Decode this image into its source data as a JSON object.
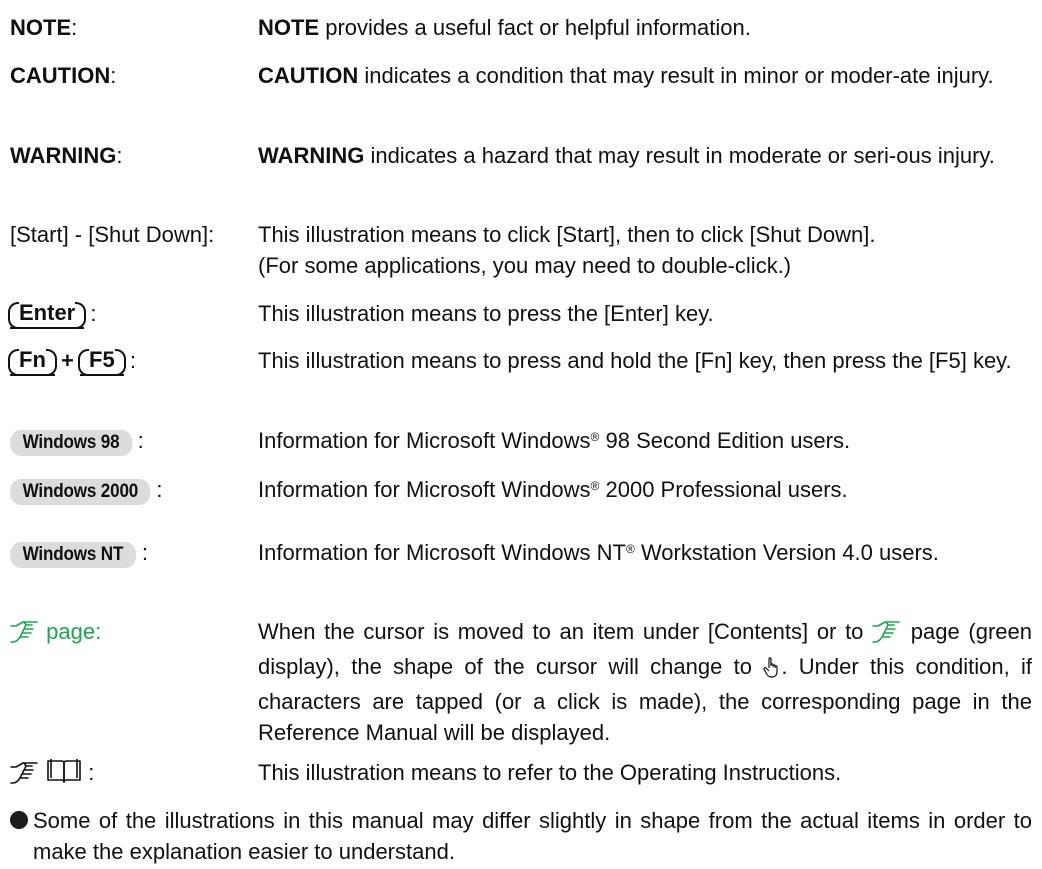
{
  "rows": [
    {
      "term": "NOTE",
      "colon": ":",
      "lead": "NOTE",
      "text": " provides a useful fact or helpful information."
    },
    {
      "term": "CAUTION",
      "colon": ":",
      "lead": "CAUTION",
      "text": " indicates a condition that may result in minor or moder-ate injury."
    },
    {
      "term": "WARNING",
      "colon": ":",
      "lead": "WARNING",
      "text": " indicates a hazard that may result in moderate or seri-ous injury."
    },
    {
      "term": "[Start] - [Shut Down]:",
      "text": "This illustration means to click [Start], then to click [Shut Down].",
      "text2": "(For some applications, you may need to double-click.)"
    },
    {
      "key": "Enter",
      "colon": ":",
      "text": "This illustration means to press the [Enter] key."
    },
    {
      "key1": "Fn",
      "plus": "+",
      "key2": "F5",
      "colon": ":",
      "text": "This illustration means to press and hold the [Fn] key, then press the [F5] key."
    },
    {
      "badge": "Windows 98",
      "colon": ":",
      "text_a": "Information for Microsoft Windows",
      "reg": "®",
      "text_b": " 98 Second Edition users."
    },
    {
      "badge": "Windows 2000",
      "colon": ":",
      "text_a": "Information for Microsoft Windows",
      "reg": "®",
      "text_b": " 2000 Professional users."
    },
    {
      "badge": "Windows NT",
      "colon": ":",
      "text_a": "Information for Microsoft Windows NT",
      "reg": "®",
      "text_b": " Workstation Version 4.0 users."
    },
    {
      "term": "page:",
      "text_a": "When the cursor is moved to an item under [Contents] or to ",
      "text_b": " page (green display), the shape of the cursor will change to ",
      "text_c": ". Under this condition, if characters are tapped (or a click is made), the corresponding page in the Reference Manual will be displayed."
    },
    {
      "colon": ":",
      "text": "This illustration means to refer to the Operating Instructions."
    }
  ],
  "bullet": "Some of the illustrations in this manual may differ slightly in shape from the actual items in order to make the explanation easier to understand.",
  "colors": {
    "link_green": "#1aa84a",
    "badge_gray": "#dcdcdc",
    "text": "#111111"
  },
  "icons": [
    "pointing-hand-icon",
    "book-icon",
    "hand-cursor-icon"
  ]
}
